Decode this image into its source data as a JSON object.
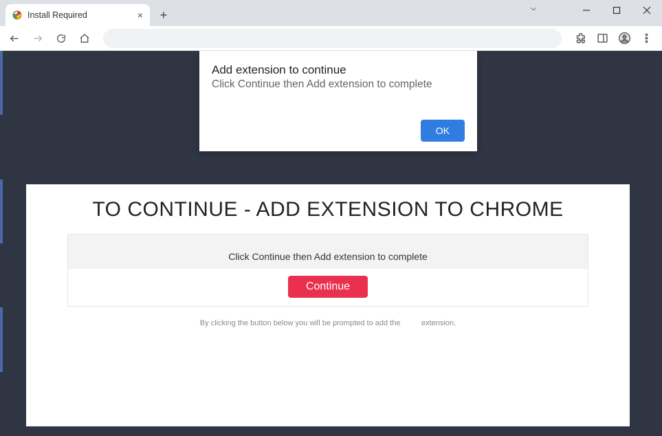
{
  "tab": {
    "title": "Install Required"
  },
  "dialog": {
    "title": "Add extension to continue",
    "subtitle": "Click Continue then Add extension to complete",
    "ok_label": "OK"
  },
  "page": {
    "heading": "TO CONTINUE - ADD EXTENSION TO CHROME",
    "instruction": "Click Continue then Add extension to complete",
    "continue_label": "Continue",
    "footnote_prefix": "By clicking the button below you will be prompted to add the",
    "footnote_suffix": "extension."
  }
}
